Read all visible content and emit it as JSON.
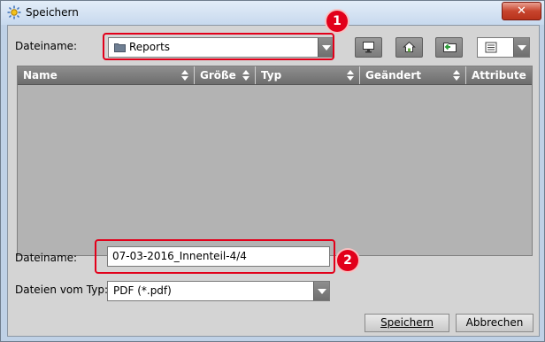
{
  "window": {
    "title": "Speichern",
    "close_label": "✕"
  },
  "top": {
    "label": "Dateiname:",
    "folder": "Reports"
  },
  "table": {
    "columns": [
      {
        "label": "Name"
      },
      {
        "label": "Größe"
      },
      {
        "label": "Typ"
      },
      {
        "label": "Geändert"
      },
      {
        "label": "Attribute"
      }
    ]
  },
  "filename": {
    "label": "Dateiname:",
    "value": "07-03-2016_Innenteil-4/4"
  },
  "filetype": {
    "label": "Dateien vom Typ:",
    "value": "PDF (*.pdf)"
  },
  "buttons": {
    "save": "Speichern",
    "cancel": "Abbrechen"
  },
  "callouts": [
    {
      "number": "1"
    },
    {
      "number": "2"
    }
  ],
  "colors": {
    "callout": "#e2001a",
    "header": "#7d7d7d",
    "panel": "#d4d4d4"
  }
}
